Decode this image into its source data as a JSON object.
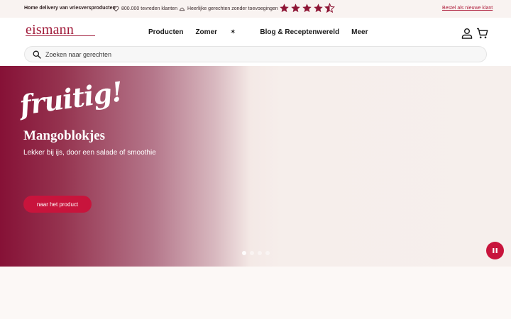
{
  "topbar": {
    "headline": "Home delivery van vriesversproducten",
    "usp_customers": "800.000 tevreden klanten",
    "usp_dishes": "Heerlijke gerechten zonder toevoegingen",
    "rating_stars": 4.5,
    "new_customer_link": "Bestel als nieuwe klant"
  },
  "header": {
    "logo_text": "eismann",
    "nav": [
      "Producten",
      "Zomer",
      "Blog & Receptenwereld",
      "Meer"
    ],
    "nav_icon_zomer": "sun-icon",
    "search_placeholder": "Zoeken naar gerechten"
  },
  "hero": {
    "script_text": "fruitig!",
    "title": "Mangoblokjes",
    "subtitle": "Lekker bij ijs, door een salade of smoothie",
    "button_label": "naar het product",
    "slide_count": 4,
    "active_slide": 1
  },
  "colors": {
    "brand": "#a11c3b",
    "accent": "#c8143c",
    "hero_dark": "#861136",
    "page_bg": "#fcf8f6"
  }
}
